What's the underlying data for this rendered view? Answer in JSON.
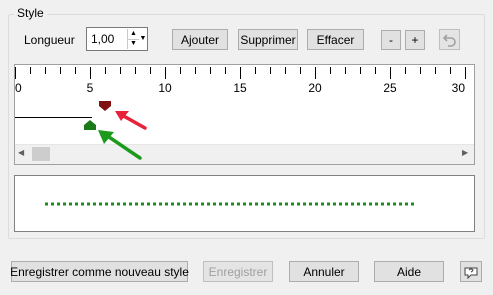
{
  "group": {
    "title": "Style"
  },
  "length": {
    "label": "Longueur",
    "value": "1,00"
  },
  "buttons": {
    "add": "Ajouter",
    "delete": "Supprimer",
    "clear": "Effacer",
    "minus": "-",
    "plus": "+",
    "undo_icon": "undo-icon"
  },
  "ruler": {
    "tick_labels": [
      "0",
      "5",
      "10",
      "15",
      "20",
      "25",
      "30"
    ],
    "min": 0,
    "max": 30,
    "major_step": 5,
    "minor_step": 1,
    "line_end": 5,
    "dash_marker": 6,
    "space_marker": 5,
    "marker_top_color": "#7f1010",
    "marker_bottom_color": "#1a7a1a",
    "arrow_red_color": "#e8223a",
    "arrow_green_color": "#1c9a1c",
    "scroll_position": 0
  },
  "preview": {
    "line_color": "#1a8f1a",
    "pattern": "dotted"
  },
  "footer": {
    "save_new": "Enregistrer comme nouveau style",
    "save": "Enregistrer",
    "cancel": "Annuler",
    "help": "Aide",
    "help_icon": "context-help-icon"
  }
}
